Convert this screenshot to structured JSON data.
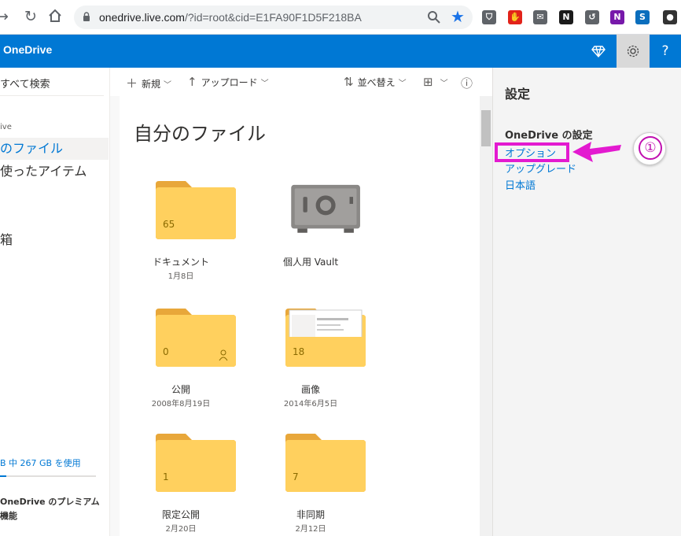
{
  "browser": {
    "url_host": "onedrive.live.com",
    "url_path": "/?id=root&cid=E1FA90F1D5F218BA",
    "extensions": [
      {
        "name": "pocket-icon",
        "color": "#5f6368",
        "glyph": "⛉"
      },
      {
        "name": "adblock-icon",
        "color": "#e2231a",
        "glyph": "✋"
      },
      {
        "name": "mail-icon",
        "color": "#5f6368",
        "glyph": "✉"
      },
      {
        "name": "notion-icon",
        "color": "#1a1a1a",
        "glyph": "N"
      },
      {
        "name": "history-icon",
        "color": "#5f6368",
        "glyph": "↺"
      },
      {
        "name": "onenote-icon",
        "color": "#7719aa",
        "glyph": "N"
      },
      {
        "name": "sway-icon",
        "color": "#0a6ebd",
        "glyph": "S"
      },
      {
        "name": "profile-icon",
        "color": "#333333",
        "glyph": "●"
      }
    ]
  },
  "app": {
    "title": "OneDrive",
    "accent": "#0078d4"
  },
  "sidebar": {
    "search": "すべて検索",
    "section": "ive",
    "items": [
      {
        "label": "のファイル",
        "active": true
      },
      {
        "label": "使ったアイテム",
        "active": false
      },
      {
        "label": "箱",
        "active": false
      }
    ],
    "storage": "B 中 267 GB を使用",
    "premium_line1": "OneDrive のプレミアム",
    "premium_line2": "機能"
  },
  "commandbar": {
    "new": "新規",
    "upload": "アップロード",
    "sort": "並べ替え"
  },
  "main": {
    "title": "自分のファイル",
    "items": [
      {
        "name": "ドキュメント",
        "date": "1月8日",
        "count": "65",
        "kind": "folder"
      },
      {
        "name": "個人用 Vault",
        "date": "",
        "count": "",
        "kind": "vault"
      },
      {
        "name": "公開",
        "date": "2008年8月19日",
        "count": "0",
        "kind": "shared"
      },
      {
        "name": "画像",
        "date": "2014年6月5日",
        "count": "18",
        "kind": "photos"
      },
      {
        "name": "限定公開",
        "date": "2月20日",
        "count": "1",
        "kind": "folder"
      },
      {
        "name": "非同期",
        "date": "2月12日",
        "count": "7",
        "kind": "folder"
      }
    ]
  },
  "settings_panel": {
    "title": "設定",
    "heading": "OneDrive の設定",
    "links": [
      "オプション",
      "アップグレード",
      "日本語"
    ]
  },
  "annotation": {
    "number": "①",
    "color": "#e31ad0"
  }
}
